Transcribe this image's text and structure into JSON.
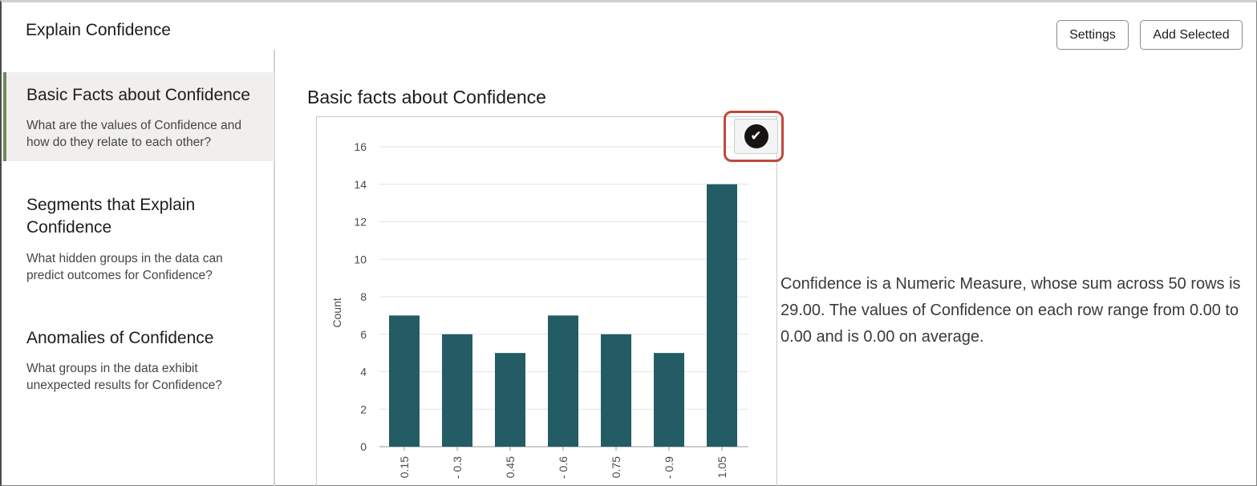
{
  "dialog": {
    "title": "Explain Confidence",
    "settings_label": "Settings",
    "add_selected_label": "Add Selected"
  },
  "sidebar": {
    "items": [
      {
        "title": "Basic Facts about Confidence",
        "description": "What are the values of Confidence and how do they relate to each other?",
        "active": true
      },
      {
        "title": "Segments that Explain Confidence",
        "description": "What hidden groups in the data can predict outcomes for Confidence?",
        "active": false
      },
      {
        "title": "Anomalies of Confidence",
        "description": "What groups in the data exhibit unexpected results for Confidence?",
        "active": false
      }
    ]
  },
  "main": {
    "section_title": "Basic facts about Confidence",
    "select_icon": "check-circle-icon",
    "summary": "Confidence is a Numeric Measure, whose sum across 50 rows is 29.00. The values of Confidence on each row range from 0.00 to 0.00 and is 0.00 on average."
  },
  "colors": {
    "bar": "#245c66",
    "highlight": "#c0483a",
    "active_bg": "#f0efed"
  },
  "chart_data": {
    "type": "bar",
    "categories": [
      "0.15",
      "0.3",
      "0.45",
      "0.6",
      "0.75",
      "0.9",
      "1.05"
    ],
    "category_labels": [
      "0.15",
      "- 0.3",
      "0.45",
      "- 0.6",
      "0.75",
      "- 0.9",
      "1.05"
    ],
    "values": [
      7,
      6,
      5,
      7,
      6,
      5,
      14
    ],
    "ylabel": "Count",
    "ylim": [
      0,
      16
    ],
    "yticks": [
      0,
      2,
      4,
      6,
      8,
      10,
      12,
      14,
      16
    ],
    "grid": true
  }
}
